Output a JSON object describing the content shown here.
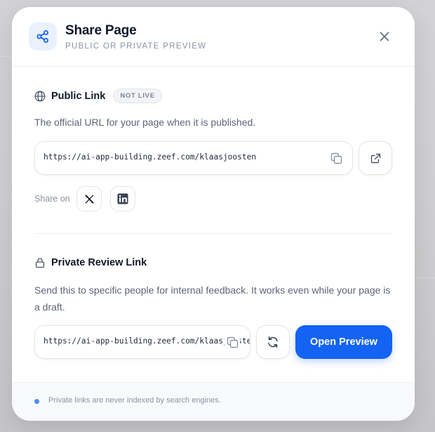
{
  "dialog": {
    "title": "Share Page",
    "subtitle": "PUBLIC OR PRIVATE PREVIEW",
    "close_label": "Close"
  },
  "public_link": {
    "title": "Public Link",
    "status_badge": "NOT LIVE",
    "description": "The official URL for your page when it is published.",
    "url": "https://ai-app-building.zeef.com/klaasjoosten",
    "share_label": "Share on",
    "share_targets": [
      "X",
      "LinkedIn"
    ]
  },
  "private_link": {
    "title": "Private Review Link",
    "description": "Send this to specific people for internal feedback. It works even while your page is a draft.",
    "url": "https://ai-app-building.zeef.com/klaasjoosten",
    "primary_button": "Open Preview"
  },
  "footer": {
    "note": "Private links are never indexed by search engines."
  },
  "icons": {
    "header": "share-icon",
    "close": "close-icon",
    "public": "globe-icon",
    "private": "lock-icon",
    "copy": "copy-icon",
    "open_external": "external-link-icon",
    "regenerate": "refresh-icon",
    "x": "x-logo-icon",
    "linkedin": "linkedin-logo-icon"
  },
  "colors": {
    "accent": "#1463f3",
    "icon_box": "#e9f1fd",
    "footer_dot": "#4a8ff0"
  }
}
